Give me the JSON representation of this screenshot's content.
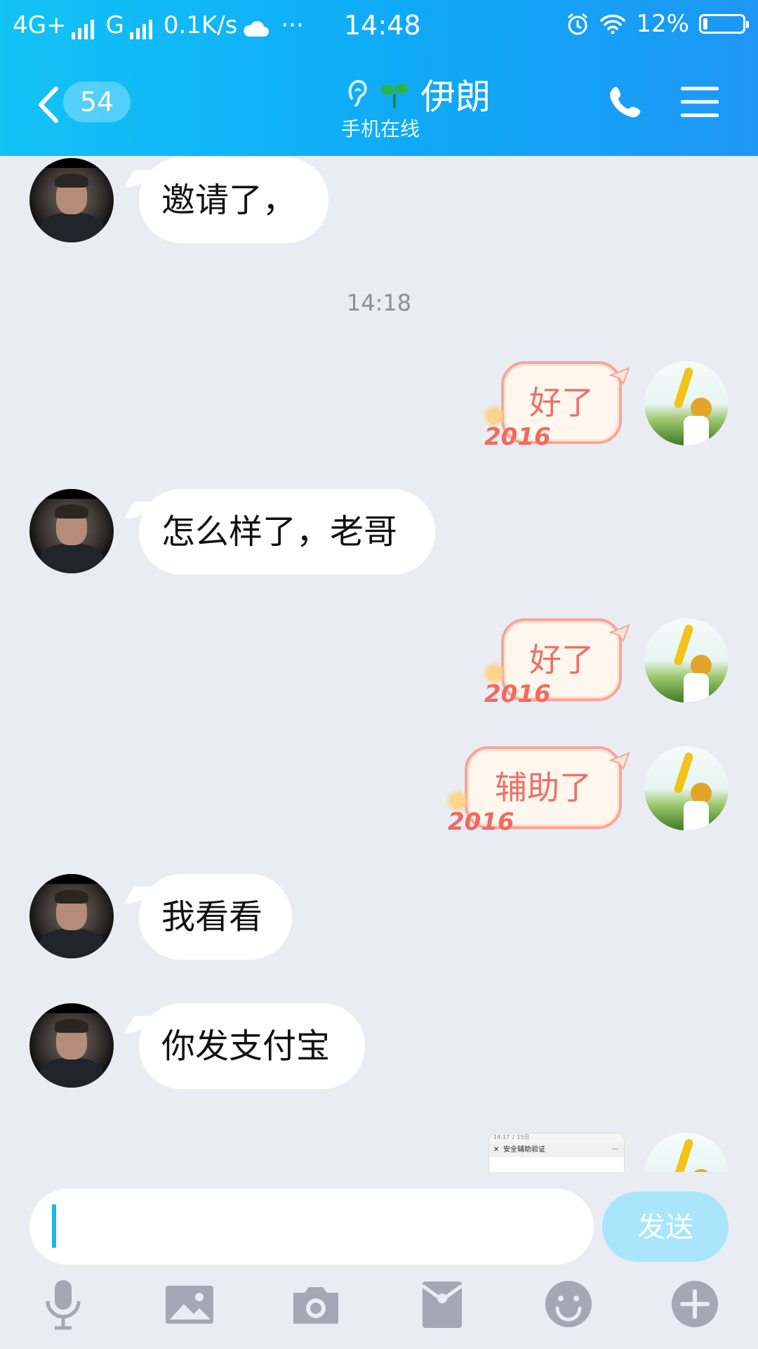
{
  "status_bar": {
    "network": "4G+",
    "network2": "G",
    "speed": "0.1K/s",
    "more": "···",
    "time": "14:48",
    "battery": "12%",
    "battery_level": 0.12
  },
  "header": {
    "back_badge": "54",
    "title": "伊朗",
    "subtitle": "手机在线"
  },
  "messages": [
    {
      "side": "in",
      "text": "邀请了，"
    },
    {
      "side": "out",
      "text": "好了"
    },
    {
      "side": "in",
      "text": "怎么样了，老哥"
    },
    {
      "side": "out",
      "text": "好了"
    },
    {
      "side": "out",
      "text": "辅助了"
    },
    {
      "side": "in",
      "text": "我看看"
    },
    {
      "side": "in",
      "text": "你发支付宝"
    }
  ],
  "timestamp": "14:18",
  "bubble_decoration": "2016",
  "screenshot_preview": {
    "status": "14:17 ♪ 15日",
    "title": "安全辅助验证"
  },
  "input": {
    "value": "",
    "send_label": "发送"
  },
  "toolbar_icons": [
    "microphone-icon",
    "image-icon",
    "camera-icon",
    "red-packet-icon",
    "emoji-icon",
    "plus-icon"
  ],
  "colors": {
    "header": "#0fa9f7",
    "accent": "#1db4f0",
    "out_bubble_border": "#f7a59c",
    "out_bubble_text": "#ef6f67",
    "send_button": "#a9e6fb",
    "background": "#eaecf3"
  }
}
